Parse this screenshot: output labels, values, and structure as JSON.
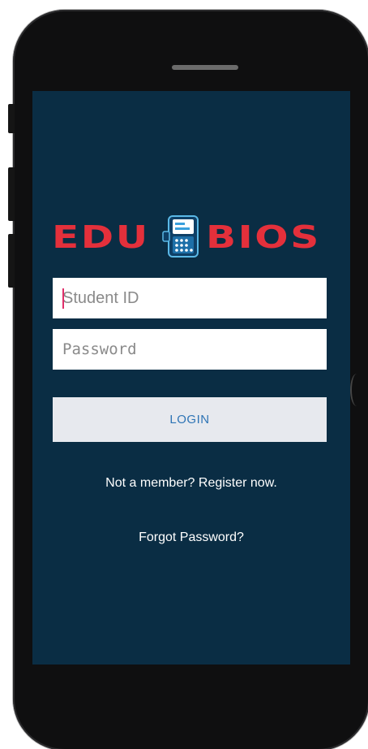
{
  "app": {
    "logo": {
      "left_text": "EDU",
      "right_text": "BIOS",
      "brand_color": "#e4303b",
      "icon": "biometric-device-icon"
    }
  },
  "login_form": {
    "student_id": {
      "value": "",
      "placeholder": "Student ID"
    },
    "password": {
      "value": "",
      "placeholder": "Password"
    },
    "login_label": "LOGIN"
  },
  "links": {
    "register": "Not a member? Register now.",
    "forgot_password": "Forgot Password?"
  },
  "colors": {
    "screen_background": "#0a2d44",
    "button_background": "#e7e9ee",
    "button_text": "#2e74b5",
    "link_text": "#ffffff",
    "cursor": "#e0306a"
  }
}
